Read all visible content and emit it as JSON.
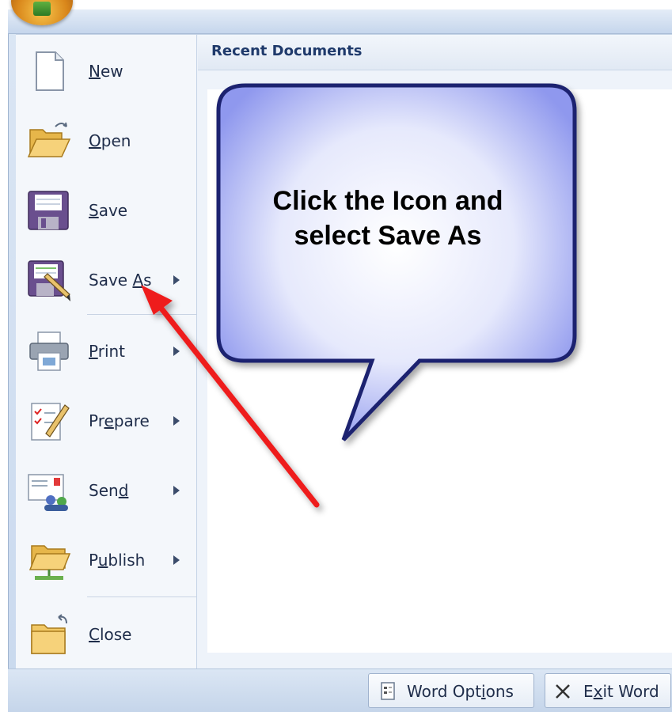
{
  "recent": {
    "title": "Recent Documents"
  },
  "menu": {
    "items": [
      {
        "label_pre": "",
        "label_ul": "N",
        "label_post": "ew",
        "has_submenu": false,
        "icon": "new-document-icon"
      },
      {
        "label_pre": "",
        "label_ul": "O",
        "label_post": "pen",
        "has_submenu": false,
        "icon": "open-folder-icon"
      },
      {
        "label_pre": "",
        "label_ul": "S",
        "label_post": "ave",
        "has_submenu": false,
        "icon": "floppy-disk-icon"
      },
      {
        "label_pre": "Save ",
        "label_ul": "A",
        "label_post": "s",
        "has_submenu": true,
        "icon": "save-as-icon"
      },
      {
        "label_pre": "",
        "label_ul": "P",
        "label_post": "rint",
        "has_submenu": true,
        "icon": "printer-icon"
      },
      {
        "label_pre": "Pr",
        "label_ul": "e",
        "label_post": "pare",
        "has_submenu": true,
        "icon": "prepare-icon"
      },
      {
        "label_pre": "Sen",
        "label_ul": "d",
        "label_post": "",
        "has_submenu": true,
        "icon": "send-icon"
      },
      {
        "label_pre": "P",
        "label_ul": "u",
        "label_post": "blish",
        "has_submenu": true,
        "icon": "publish-icon"
      },
      {
        "label_pre": "",
        "label_ul": "C",
        "label_post": "lose",
        "has_submenu": false,
        "icon": "close-folder-icon"
      }
    ]
  },
  "footer": {
    "options_pre": "Word Opt",
    "options_ul": "i",
    "options_post": "ons",
    "exit_pre": "E",
    "exit_ul": "x",
    "exit_post": "it Word"
  },
  "callout": {
    "line1": "Click the Icon and",
    "line2": "select Save As"
  },
  "colors": {
    "callout_fill": "#b9c0f4",
    "callout_border": "#1b2470",
    "arrow": "#ee1c1c"
  }
}
